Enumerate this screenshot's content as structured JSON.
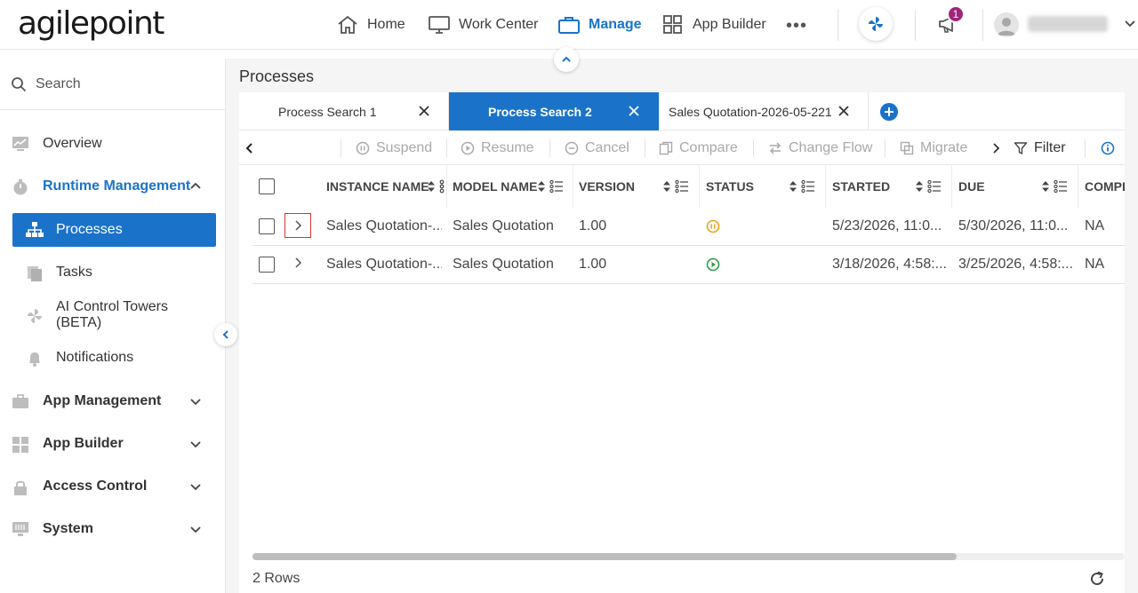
{
  "brand": {
    "logo_text": "agilepoint"
  },
  "topnav": {
    "items": [
      {
        "label": "Home",
        "icon": "home-icon"
      },
      {
        "label": "Work Center",
        "icon": "monitor-icon"
      },
      {
        "label": "Manage",
        "icon": "briefcase-icon",
        "active": true
      },
      {
        "label": "App Builder",
        "icon": "grid-icon"
      }
    ],
    "more": "•••",
    "notifications_count": "1"
  },
  "sidebar": {
    "search_placeholder": "Search",
    "items": [
      {
        "label": "Overview",
        "icon": "chart-icon"
      },
      {
        "label": "Runtime Management",
        "icon": "stopwatch-icon",
        "expanded": true
      },
      {
        "label": "App Management",
        "icon": "briefcase-icon"
      },
      {
        "label": "App Builder",
        "icon": "grid-icon"
      },
      {
        "label": "Access Control",
        "icon": "lock-icon"
      },
      {
        "label": "System",
        "icon": "server-icon"
      }
    ],
    "subitems": [
      {
        "label": "Processes",
        "icon": "hierarchy-icon",
        "active": true
      },
      {
        "label": "Tasks",
        "icon": "tasks-icon"
      },
      {
        "label": "AI Control Towers (BETA)",
        "icon": "ai-icon"
      },
      {
        "label": "Notifications",
        "icon": "bell-icon"
      }
    ]
  },
  "main": {
    "title": "Processes",
    "tabs": [
      {
        "label": "Process Search 1"
      },
      {
        "label": "Process Search 2",
        "active": true
      },
      {
        "label": "Sales Quotation-2026-05-221"
      }
    ],
    "toolbar": {
      "suspend": "Suspend",
      "resume": "Resume",
      "cancel": "Cancel",
      "compare": "Compare",
      "change_flow": "Change Flow",
      "migrate": "Migrate",
      "filter": "Filter"
    },
    "columns": [
      "INSTANCE NAME",
      "MODEL NAME",
      "VERSION",
      "STATUS",
      "STARTED",
      "DUE",
      "COMPL"
    ],
    "rows": [
      {
        "instance": "Sales Quotation-...",
        "model": "Sales Quotation",
        "version": "1.00",
        "status": "suspended",
        "started": "5/23/2026, 11:0...",
        "due": "5/30/2026, 11:0...",
        "completed": "NA"
      },
      {
        "instance": "Sales Quotation-...",
        "model": "Sales Quotation",
        "version": "1.00",
        "status": "running",
        "started": "3/18/2026, 4:58:...",
        "due": "3/25/2026, 4:58:...",
        "completed": "NA"
      }
    ],
    "status_colors": {
      "suspended": "#e8a317",
      "running": "#2e9b47"
    },
    "footer": {
      "rows_label": "2 Rows"
    }
  },
  "colors": {
    "accent": "#1a73c9",
    "focus": "#d9342b"
  }
}
